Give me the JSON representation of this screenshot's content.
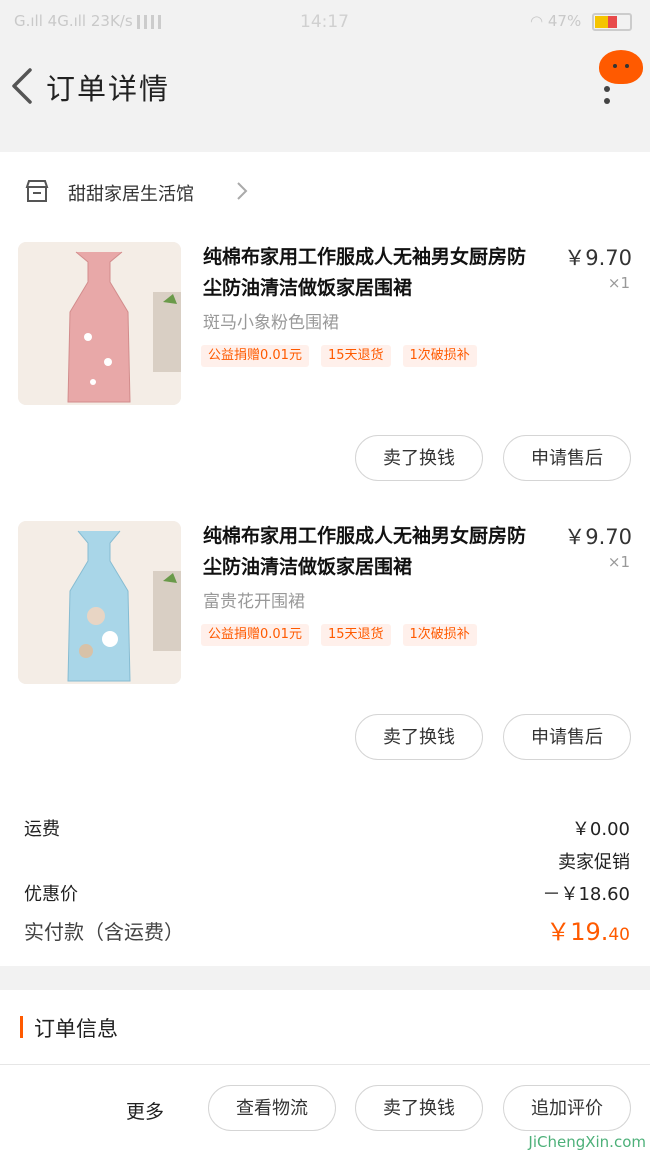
{
  "status_bar": {
    "left": "G.ıll 4G.ıll 23K/s",
    "time": "14:17",
    "battery": "47%"
  },
  "header": {
    "title": "订单详情"
  },
  "shop": {
    "name": "甜甜家居生活馆"
  },
  "products": [
    {
      "title": "纯棉布家用工作服成人无袖男女厨房防尘防油清洁做饭家居围裙",
      "price": "￥9.70",
      "qty": "×1",
      "variant": "斑马小象粉色围裙",
      "tags": [
        "公益捐赠0.01元",
        "15天退货",
        "1次破损补"
      ],
      "actions": [
        "卖了换钱",
        "申请售后"
      ],
      "thumb_color": "#e8a8a8"
    },
    {
      "title": "纯棉布家用工作服成人无袖男女厨房防尘防油清洁做饭家居围裙",
      "price": "￥9.70",
      "qty": "×1",
      "variant": "富贵花开围裙",
      "tags": [
        "公益捐赠0.01元",
        "15天退货",
        "1次破损补"
      ],
      "actions": [
        "卖了换钱",
        "申请售后"
      ],
      "thumb_color": "#a9d6e8"
    }
  ],
  "summary": {
    "shipping_label": "运费",
    "shipping_value": "￥0.00",
    "promo_label": "卖家促销",
    "discount_label": "优惠价",
    "discount_value": "－￥18.60",
    "total_label": "实付款（含运费）",
    "total_currency": "￥",
    "total_int": "19.",
    "total_dec": "40"
  },
  "order_info": {
    "title": "订单信息"
  },
  "bottom_bar": {
    "more": "更多",
    "buttons": [
      "查看物流",
      "卖了换钱",
      "追加评价"
    ]
  },
  "watermark": {
    "text": "JiChengXin.com"
  },
  "colors": {
    "accent": "#ff5a00",
    "tag_bg": "#fff0eb"
  }
}
